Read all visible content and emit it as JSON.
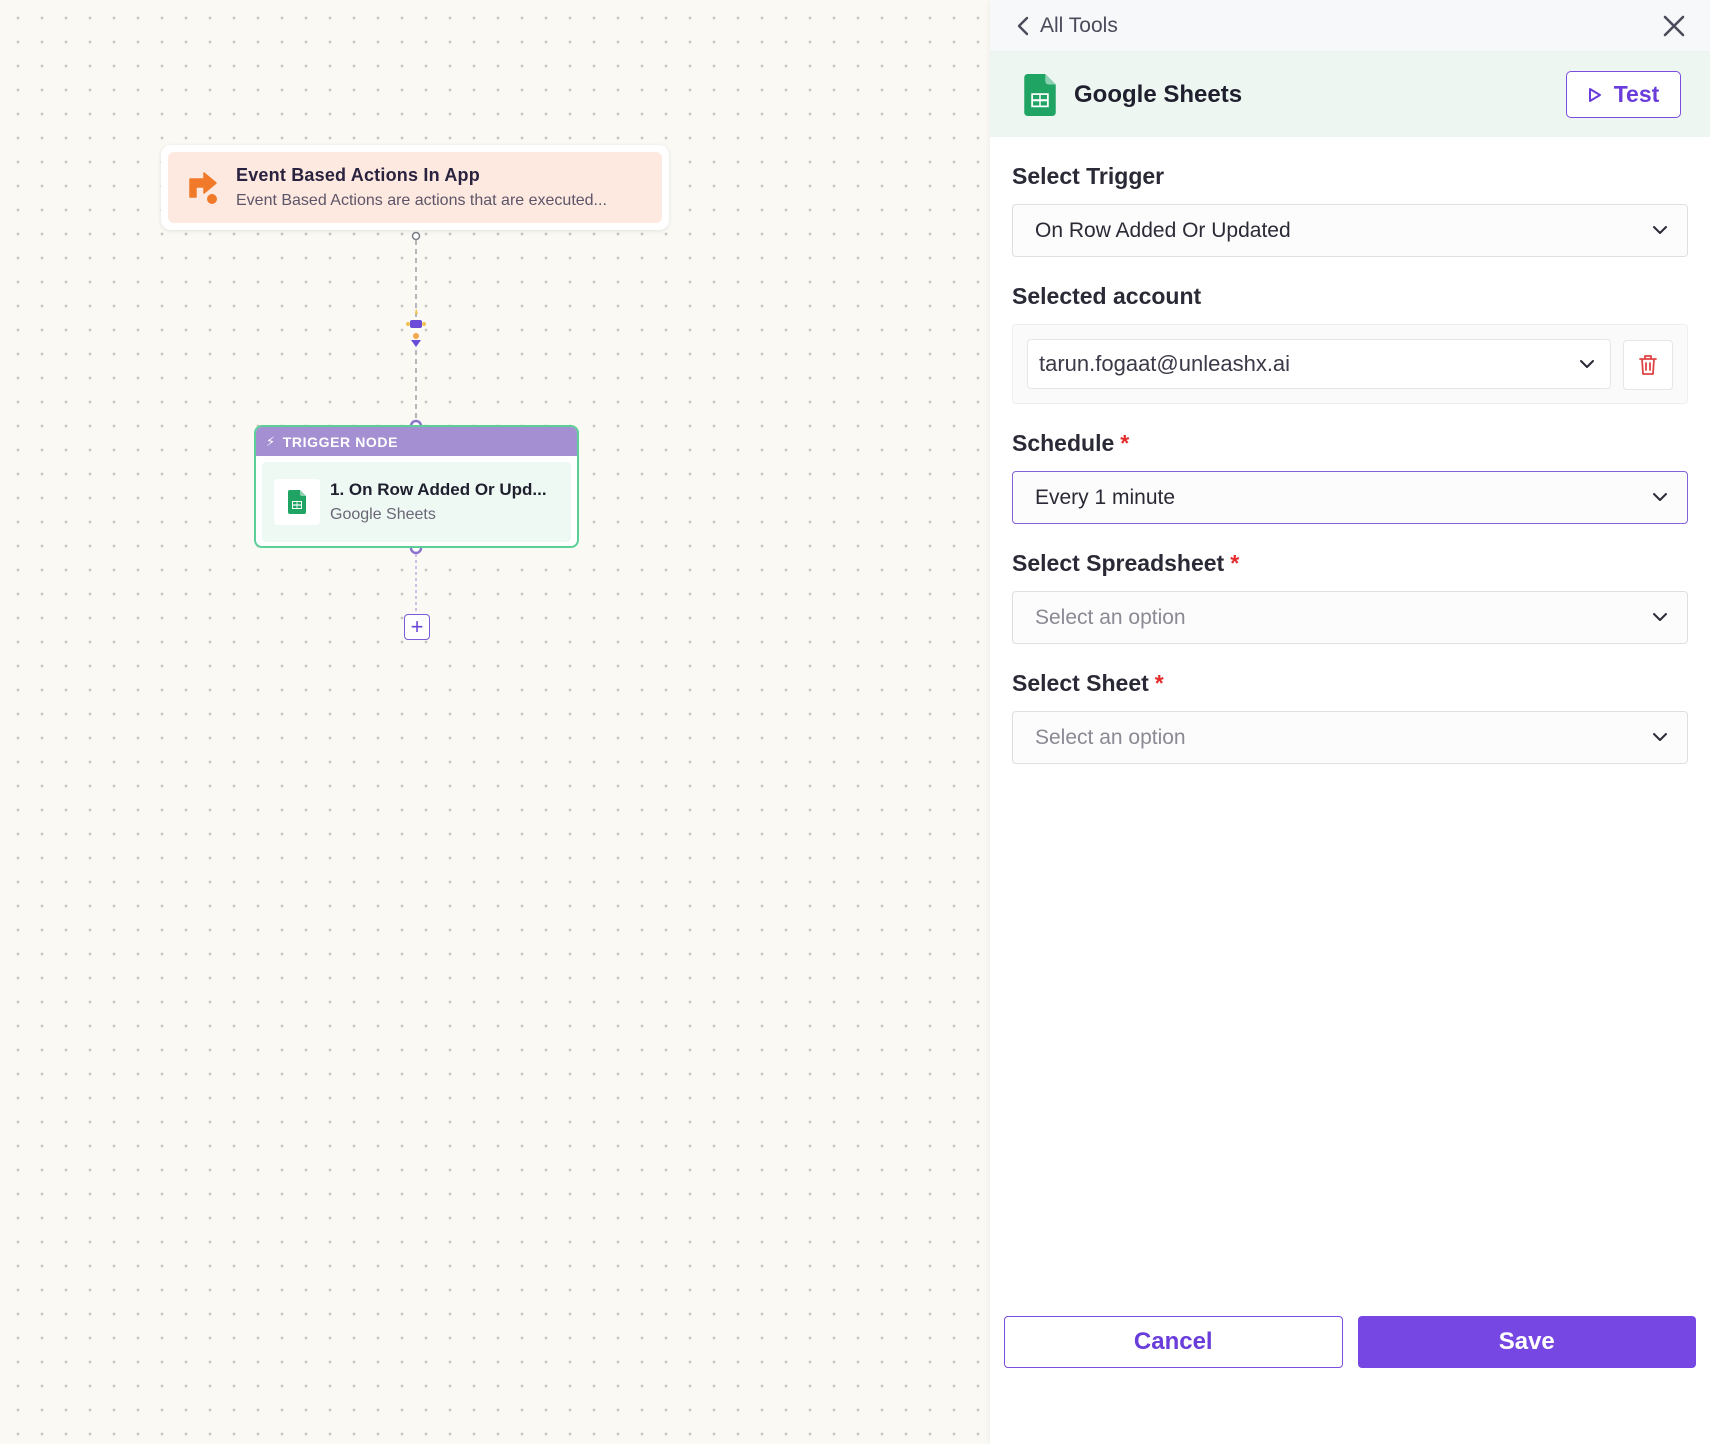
{
  "canvas": {
    "event_node": {
      "title": "Event Based Actions In App",
      "description": "Event Based Actions are actions that are executed..."
    },
    "trigger_node": {
      "header": "TRIGGER NODE",
      "title": "1. On Row Added Or Upd...",
      "subtitle": "Google Sheets"
    },
    "add_button": "+"
  },
  "panel": {
    "back_label": "All Tools",
    "tool_name": "Google Sheets",
    "test_label": "Test",
    "fields": {
      "trigger_label": "Select Trigger",
      "trigger_value": "On Row Added Or Updated",
      "account_label": "Selected account",
      "account_value": "tarun.fogaat@unleashx.ai",
      "schedule_label": "Schedule",
      "schedule_value": "Every 1 minute",
      "spreadsheet_label": "Select Spreadsheet",
      "spreadsheet_placeholder": "Select an option",
      "sheet_label": "Select Sheet",
      "sheet_placeholder": "Select an option",
      "required_mark": "*"
    },
    "cancel_label": "Cancel",
    "save_label": "Save"
  },
  "colors": {
    "accent": "#7647e2",
    "trigger_border": "#5ccf98",
    "trigger_header": "#a58fd3",
    "event_bg": "#fde9e0",
    "event_icon": "#f07a2a",
    "required": "#e52b2b",
    "sheets_green": "#20a464"
  },
  "icons": [
    "chevron-left-icon",
    "close-icon",
    "google-sheets-icon",
    "play-icon",
    "chevron-down-icon",
    "trash-icon",
    "bolt-icon",
    "event-action-icon",
    "plus-icon"
  ]
}
